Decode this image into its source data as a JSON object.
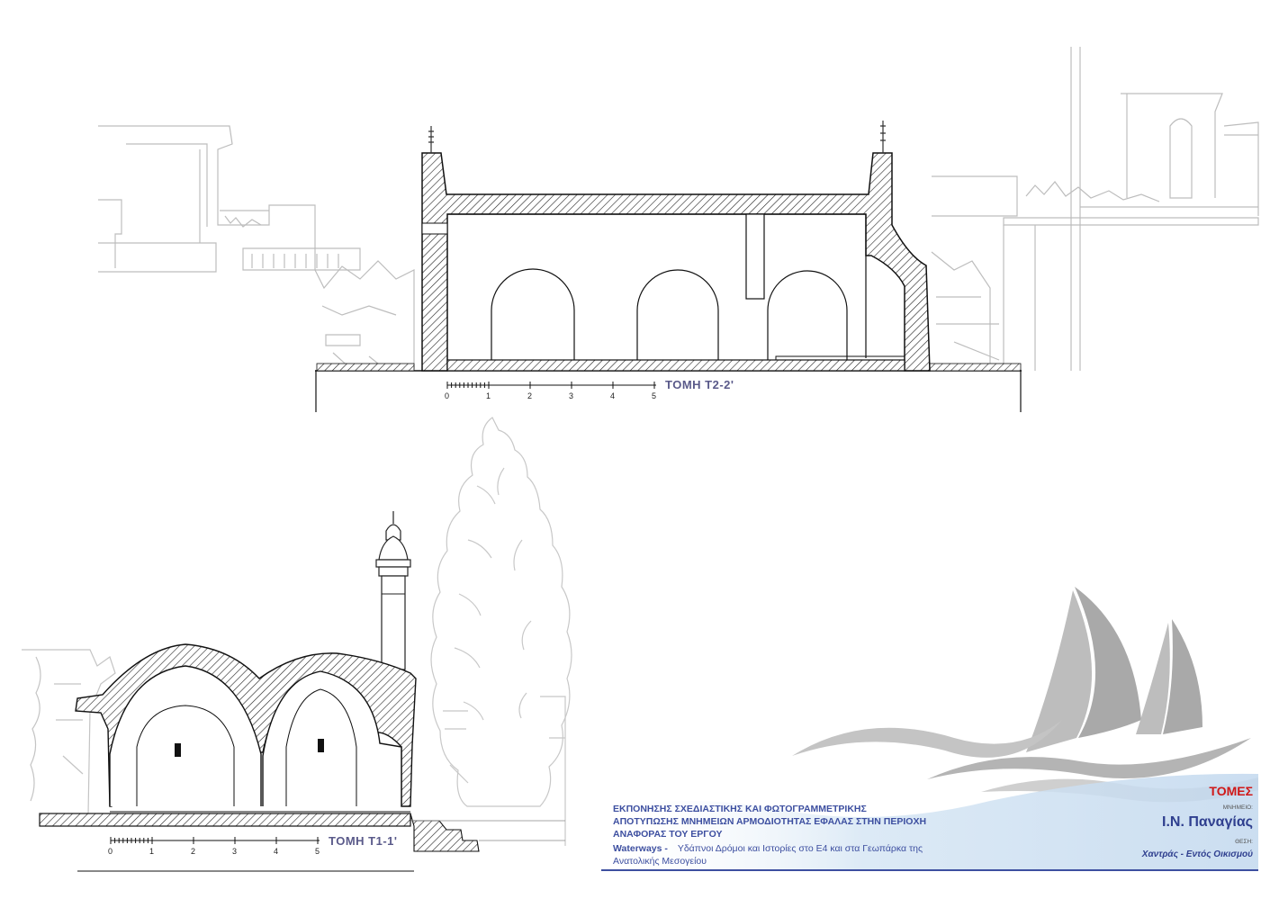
{
  "sections": {
    "top_title": "ΤΟΜΗ Τ2-2'",
    "bottom_title": "ΤΟΜΗ Τ1-1'"
  },
  "scale_labels": [
    "0",
    "1",
    "2",
    "3",
    "4",
    "5"
  ],
  "project": {
    "line1": "ΕΚΠΟΝΗΣΗΣ ΣΧΕΔΙΑΣΤΙΚΗΣ ΚΑΙ ΦΩΤΟΓΡΑΜΜΕΤΡΙΚΗΣ",
    "line2": "ΑΠΟΤΥΠΩΣΗΣ ΜΝΗΜΕΙΩΝ ΑΡΜΟΔΙΟΤΗΤΑΣ ΕΦΑΛΑΣ ΣΤΗΝ ΠΕΡΙΟΧΗ",
    "line3": "ΑΝΑΦΟΡΑΣ ΤΟΥ ΕΡΓΟΥ",
    "line4a": "Waterways -",
    "line4b": "Υδάπνοι Δρόμοι και Ιστορίες στο Ε4 και στα Γεωπάρκα της",
    "line5": "Ανατολικής Μεσογείου"
  },
  "title_block": {
    "sheet_title": "ΤΟΜΕΣ",
    "monument_label": "ΜΝΗΜΕΙΟ:",
    "monument": "Ι.Ν. Παναγίας",
    "location_label": "ΘΕΣΗ:",
    "location": "Χαντράς - Εντός Οικισμού"
  },
  "colors": {
    "section_line": "#1a1a1a",
    "background_line": "#b8b8b8",
    "title_blue": "#3d4fa0",
    "title_red": "#d01818",
    "logo_grey": "#a8a8a8",
    "wave_blue": "#cfe2f3"
  }
}
